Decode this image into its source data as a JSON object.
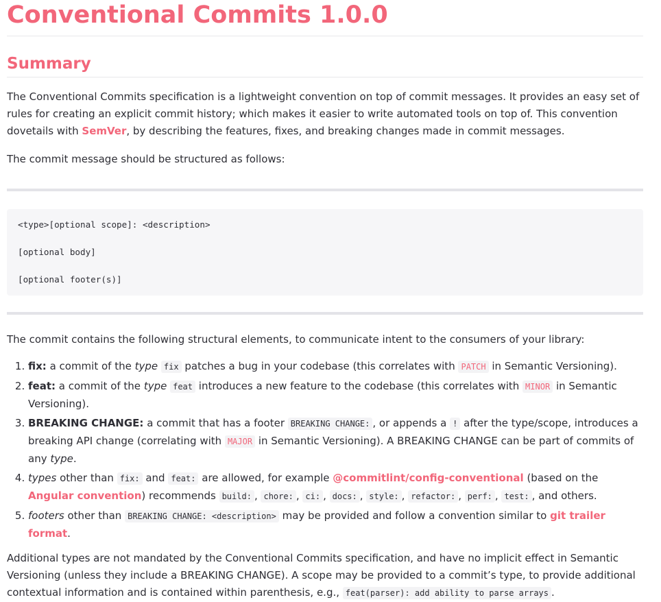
{
  "title": "Conventional Commits 1.0.0",
  "summary_heading": "Summary",
  "p1": {
    "a": "The Conventional Commits specification is a lightweight convention on top of commit messages. It provides an easy set of rules for creating an explicit commit history; which makes it easier to write automated tools on top of. This convention dovetails with ",
    "link": "SemVer",
    "b": ", by describing the features, fixes, and breaking changes made in commit messages."
  },
  "p2": "The commit message should be structured as follows:",
  "code_block": {
    "line1": "<type>[optional scope]: <description>",
    "line2": "[optional body]",
    "line3": "[optional footer(s)]"
  },
  "p3": "The commit contains the following structural elements, to communicate intent to the consumers of your library:",
  "items": [
    {
      "term": "fix:",
      "t1": " a commit of the ",
      "em": "type",
      "code": "fix",
      "t2": " patches a bug in your codebase (this correlates with ",
      "code2": "PATCH",
      "t3": " in Semantic Versioning)."
    },
    {
      "term": "feat:",
      "t1": " a commit of the ",
      "em": "type",
      "code": "feat",
      "t2": " introduces a new feature to the codebase (this correlates with ",
      "code2": "MINOR",
      "t3": " in Semantic Versioning)."
    },
    {
      "term": "BREAKING CHANGE:",
      "t1": " a commit that has a footer ",
      "code": "BREAKING CHANGE:",
      "t2": ", or appends a ",
      "code2": "!",
      "t3": " after the type/scope, introduces a breaking API change (correlating with ",
      "code3": "MAJOR",
      "t4": " in Semantic Versioning). A BREAKING CHANGE can be part of commits of any ",
      "em": "type",
      "t5": "."
    },
    {
      "em": "types",
      "t1": " other than ",
      "code1": "fix:",
      "t2": " and ",
      "code2": "feat:",
      "t3": " are allowed, for example ",
      "link1": "@commitlint/config-conventional",
      "t4": " (based on the ",
      "link2": "Angular convention",
      "t5": ") recommends ",
      "codes": [
        "build:",
        "chore:",
        "ci:",
        "docs:",
        "style:",
        "refactor:",
        "perf:",
        "test:"
      ],
      "sep": ", ",
      "t6": ", and others."
    },
    {
      "em": "footers",
      "t1": " other than ",
      "code": "BREAKING CHANGE: <description>",
      "t2": " may be provided and follow a convention similar to ",
      "link": "git trailer format",
      "t3": "."
    }
  ],
  "p4": {
    "a": "Additional types are not mandated by the Conventional Commits specification, and have no implicit effect in Semantic Versioning (unless they include a BREAKING CHANGE). A scope may be provided to a commit’s type, to provide additional contextual information and is contained within parenthesis, e.g., ",
    "code": "feat(parser): add ability to parse arrays",
    "b": "."
  },
  "colors": {
    "accent": "#f2667a",
    "text": "#2e2e35",
    "code_bg": "#f6f6f8",
    "rule": "#e3e3e8"
  }
}
